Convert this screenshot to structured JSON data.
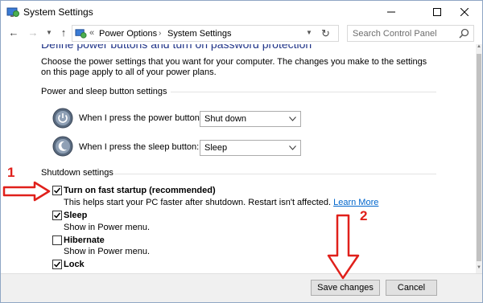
{
  "window": {
    "title": "System Settings"
  },
  "address": {
    "breadcrumbs": [
      "Power Options",
      "System Settings"
    ],
    "search_placeholder": "Search Control Panel"
  },
  "content": {
    "heading": "Define power buttons and turn on password protection",
    "description": "Choose the power settings that you want for your computer. The changes you make to the settings on this page apply to all of your power plans.",
    "power_group": {
      "title": "Power and sleep button settings",
      "power_button_label": "When I press the power button:",
      "power_button_value": "Shut down",
      "sleep_button_label": "When I press the sleep button:",
      "sleep_button_value": "Sleep"
    },
    "shutdown_group": {
      "title": "Shutdown settings",
      "items": [
        {
          "label": "Turn on fast startup (recommended)",
          "desc": "This helps start your PC faster after shutdown. Restart isn't affected.",
          "link": "Learn More",
          "checked": true
        },
        {
          "label": "Sleep",
          "desc": "Show in Power menu.",
          "checked": true
        },
        {
          "label": "Hibernate",
          "desc": "Show in Power menu.",
          "checked": false
        },
        {
          "label": "Lock",
          "checked": true
        }
      ]
    }
  },
  "footer": {
    "save_label": "Save changes",
    "cancel_label": "Cancel"
  },
  "annotations": {
    "step1": "1",
    "step2": "2"
  },
  "colors": {
    "heading": "#1e3287",
    "link": "#0066cc",
    "annotation": "#e0201b"
  }
}
